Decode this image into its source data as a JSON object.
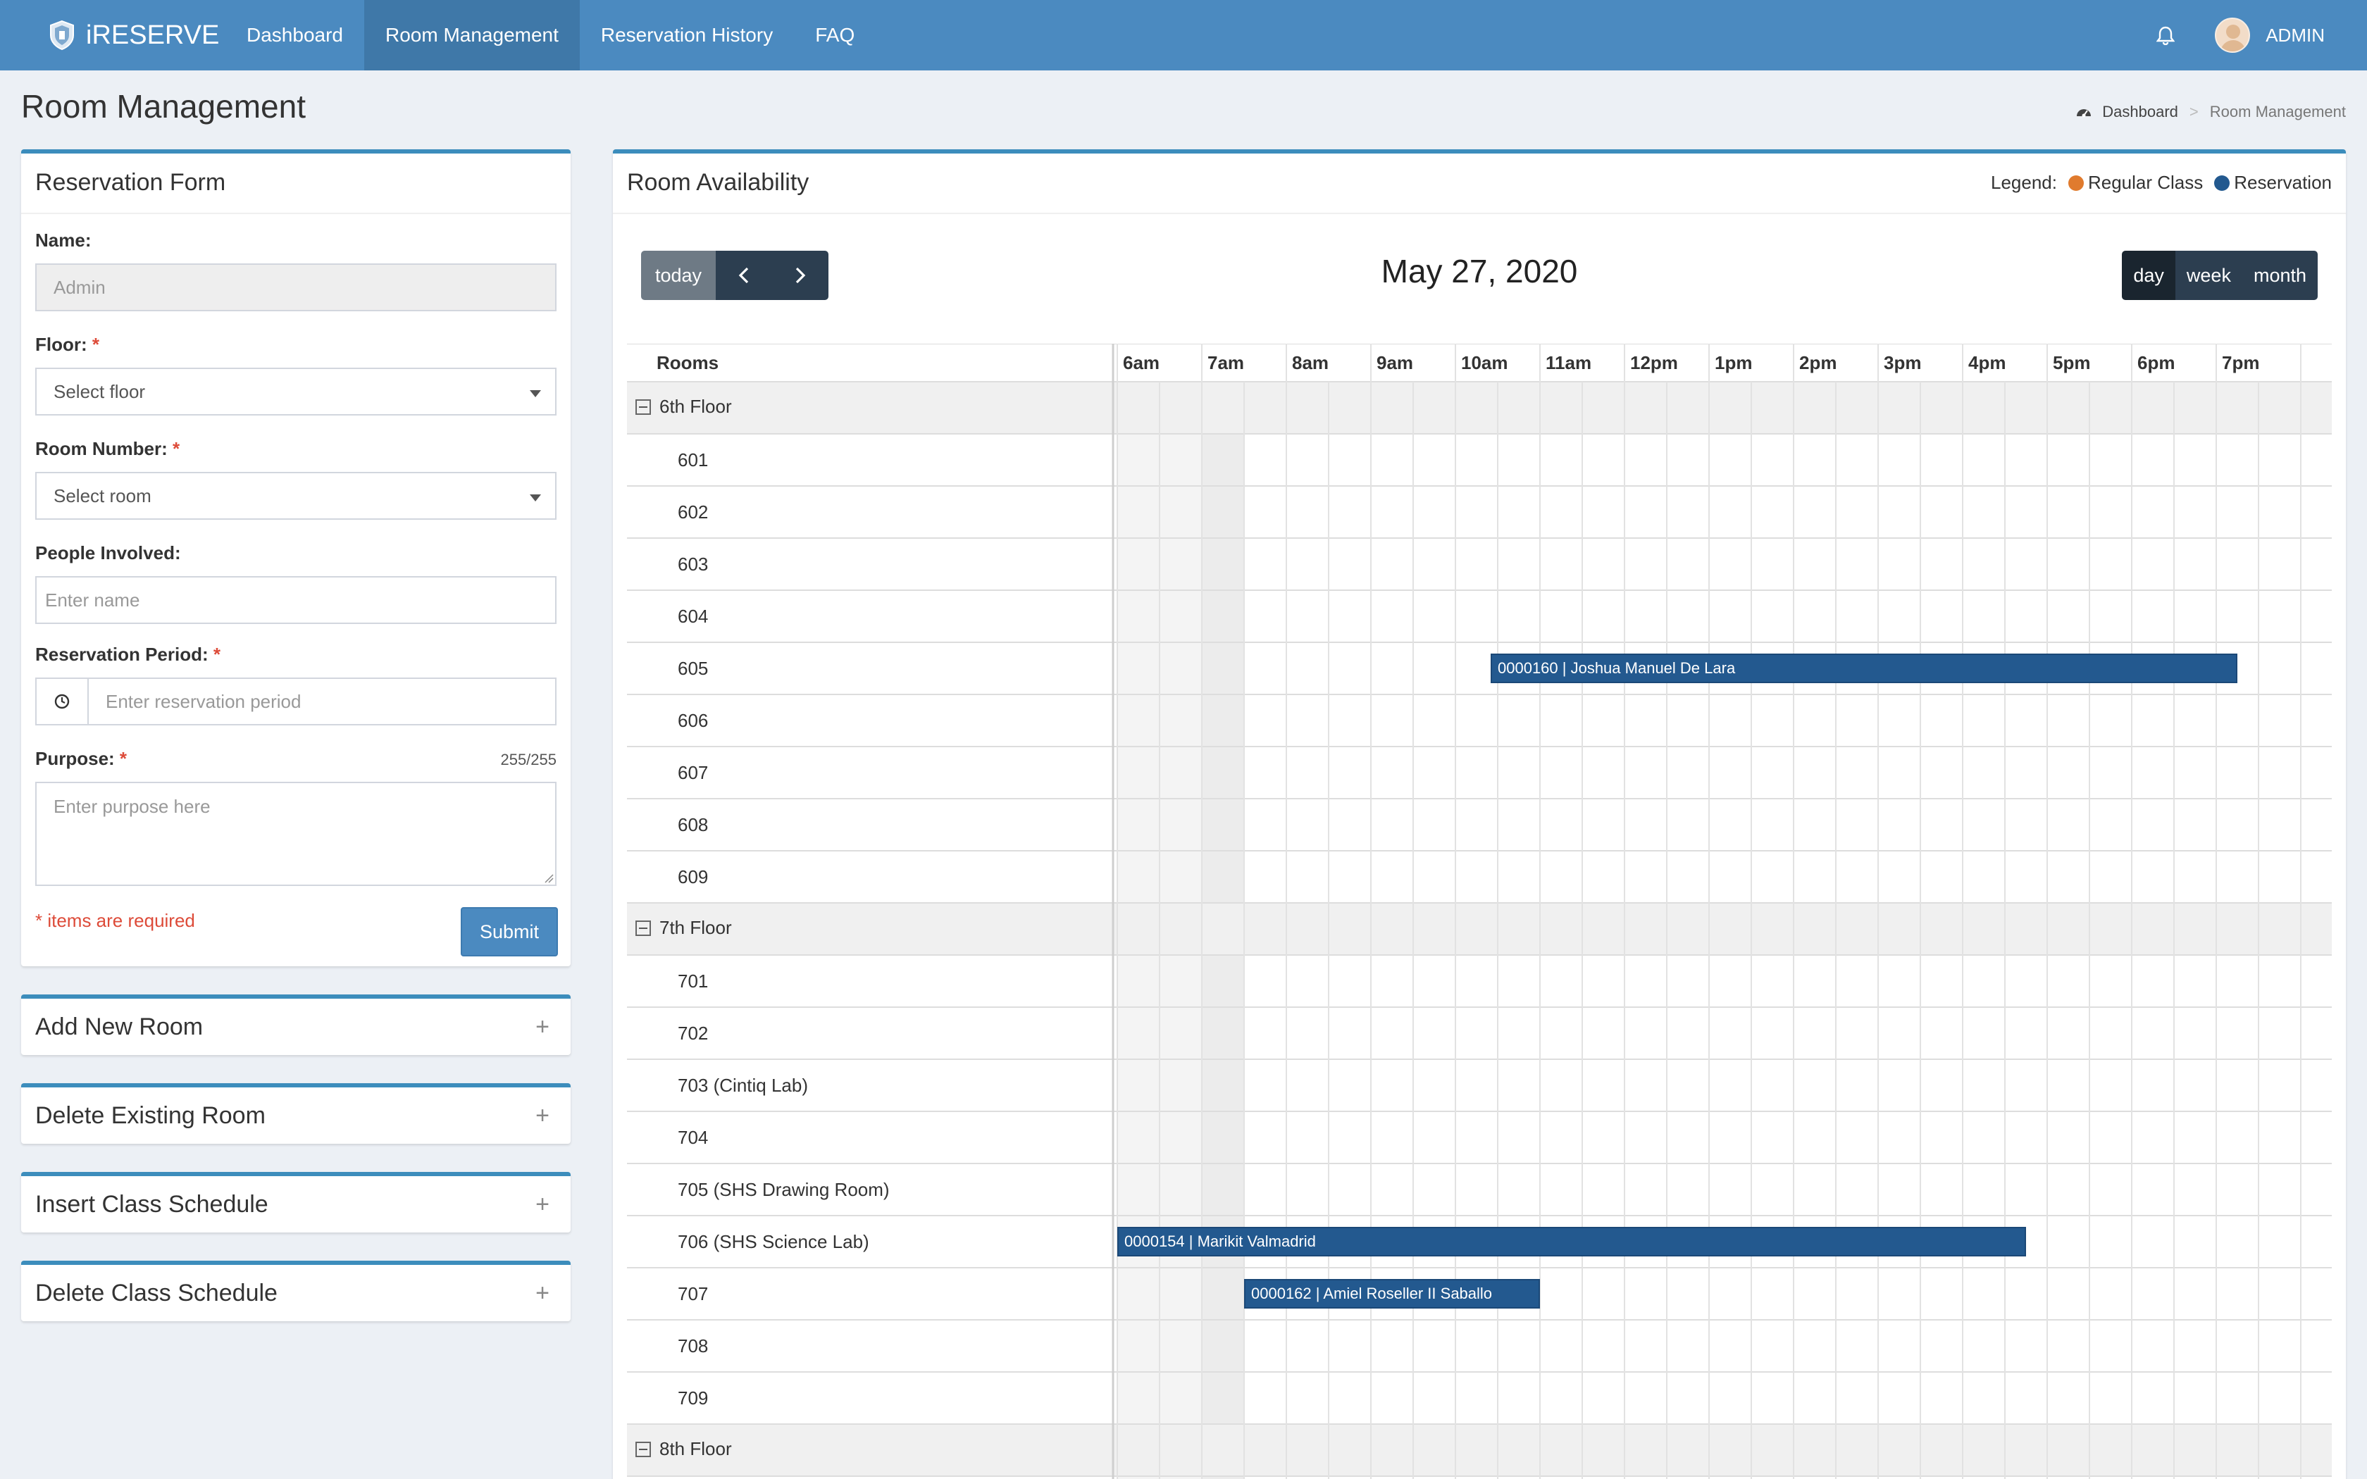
{
  "nav": {
    "brand": "iRESERVE",
    "items": [
      "Dashboard",
      "Room Management",
      "Reservation History",
      "FAQ"
    ],
    "user": "ADMIN"
  },
  "page": {
    "title": "Room Management",
    "breadcrumb": [
      "Dashboard",
      ">",
      "Room Management"
    ]
  },
  "form": {
    "title": "Reservation Form",
    "name_label": "Name:",
    "name_value": "Admin",
    "floor_label": "Floor:",
    "floor_value": "Select floor",
    "room_label": "Room Number:",
    "room_value": "Select room",
    "people_label": "People Involved:",
    "people_placeholder": "Enter name",
    "period_label": "Reservation Period:",
    "period_placeholder": "Enter reservation period",
    "purpose_label": "Purpose:",
    "purpose_counter": "255/255",
    "purpose_placeholder": "Enter purpose here",
    "required_note": "* items are required",
    "required_mark": "*",
    "submit": "Submit"
  },
  "panels": [
    "Add New Room",
    "Delete Existing Room",
    "Insert Class Schedule",
    "Delete Class Schedule"
  ],
  "panel_icon": "+",
  "availability": {
    "title": "Room Availability",
    "legend_label": "Legend:",
    "legend": [
      {
        "name": "Regular Class",
        "color": "#e07b2e"
      },
      {
        "name": "Reservation",
        "color": "#23598f"
      }
    ],
    "today": "today",
    "date": "May 27, 2020",
    "views": [
      "day",
      "week",
      "month"
    ],
    "rooms_header": "Rooms",
    "times": [
      "6am",
      "7am",
      "8am",
      "9am",
      "10am",
      "11am",
      "12pm",
      "1pm",
      "2pm",
      "3pm",
      "4pm",
      "5pm",
      "6pm",
      "7pm"
    ],
    "rows": [
      {
        "type": "group",
        "label": "6th Floor"
      },
      {
        "type": "room",
        "label": "601"
      },
      {
        "type": "room",
        "label": "602"
      },
      {
        "type": "room",
        "label": "603"
      },
      {
        "type": "room",
        "label": "604"
      },
      {
        "type": "room",
        "label": "605"
      },
      {
        "type": "room",
        "label": "606"
      },
      {
        "type": "room",
        "label": "607"
      },
      {
        "type": "room",
        "label": "608"
      },
      {
        "type": "room",
        "label": "609"
      },
      {
        "type": "group",
        "label": "7th Floor"
      },
      {
        "type": "room",
        "label": "701"
      },
      {
        "type": "room",
        "label": "702"
      },
      {
        "type": "room",
        "label": "703 (Cintiq Lab)"
      },
      {
        "type": "room",
        "label": "704"
      },
      {
        "type": "room",
        "label": "705 (SHS Drawing Room)"
      },
      {
        "type": "room",
        "label": "706 (SHS Science Lab)"
      },
      {
        "type": "room",
        "label": "707"
      },
      {
        "type": "room",
        "label": "708"
      },
      {
        "type": "room",
        "label": "709"
      },
      {
        "type": "group",
        "label": "8th Floor"
      },
      {
        "type": "room",
        "label": ""
      }
    ],
    "events": [
      {
        "room": "605",
        "label": "0000160 | Joshua Manuel De Lara",
        "start": "10:25",
        "end": "19:15"
      },
      {
        "room": "706 (SHS Science Lab)",
        "label": "0000154 | Marikit Valmadrid",
        "start": "6:00",
        "end": "16:45"
      },
      {
        "room": "707",
        "label": "0000162 | Amiel Roseller II Saballo",
        "start": "7:30",
        "end": "11:00"
      },
      {
        "room": "",
        "label": "",
        "start": "7:30",
        "end": "11:00"
      }
    ]
  }
}
